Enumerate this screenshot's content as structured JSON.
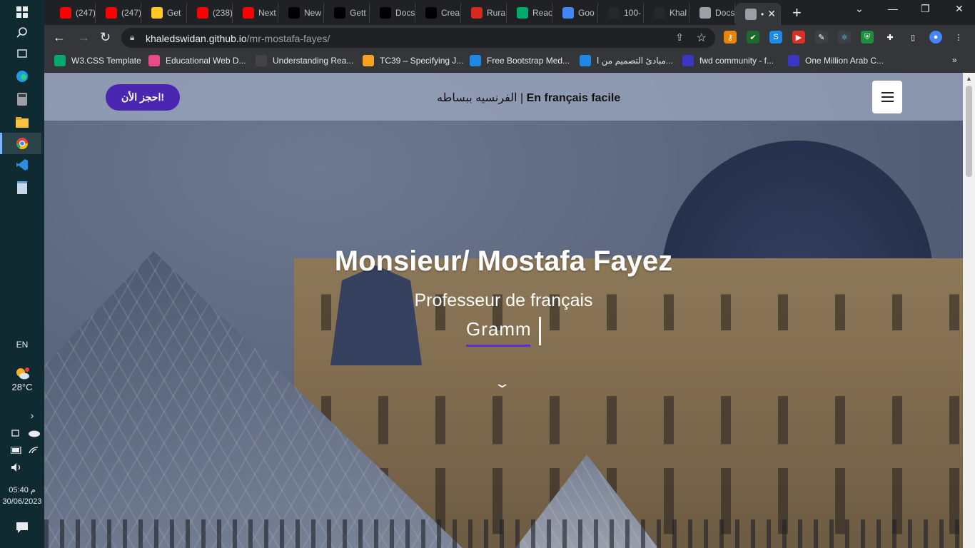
{
  "taskbar": {
    "lang": "EN",
    "weather_temp": "28°C",
    "time": "05:40 م",
    "date": "30/06/2023"
  },
  "tabs": [
    {
      "title": "(247)",
      "icon": "youtube-icon",
      "color": "#ff0000"
    },
    {
      "title": "(247)",
      "icon": "youtube-icon",
      "color": "#ff0000"
    },
    {
      "title": "Get",
      "icon": "firebase-icon",
      "color": "#ffca28"
    },
    {
      "title": "(238)",
      "icon": "youtube-icon",
      "color": "#ff0000"
    },
    {
      "title": "Next",
      "icon": "youtube-icon",
      "color": "#ff0000"
    },
    {
      "title": "New",
      "icon": "vercel-icon",
      "color": "#000000"
    },
    {
      "title": "Gett",
      "icon": "nextjs-icon",
      "color": "#000000"
    },
    {
      "title": "Docs",
      "icon": "nextjs-icon",
      "color": "#000000"
    },
    {
      "title": "Crea",
      "icon": "nextjs-icon",
      "color": "#000000"
    },
    {
      "title": "Rura",
      "icon": "canada-leaf-icon",
      "color": "#d52b1e"
    },
    {
      "title": "Reac",
      "icon": "w-icon",
      "color": "#04aa6d"
    },
    {
      "title": "Goo",
      "icon": "google-translate-icon",
      "color": "#4285f4"
    },
    {
      "title": "100-",
      "icon": "github-icon",
      "color": "#24292e"
    },
    {
      "title": "Khal",
      "icon": "github-icon",
      "color": "#24292e"
    },
    {
      "title": "Docs",
      "icon": "globe-icon",
      "color": "#9aa0a6"
    },
    {
      "title": "•",
      "icon": "globe-icon",
      "color": "#9aa0a6",
      "active": true
    }
  ],
  "toolbar": {
    "url_host": "khaledswidan.github.io",
    "url_path": "/mr-mostafa-fayes/"
  },
  "bookmarks": [
    {
      "label": "W3.CSS Template",
      "icon": "w3schools-icon",
      "color": "#04aa6d"
    },
    {
      "label": "Educational Web D...",
      "icon": "dribbble-icon",
      "color": "#ea4c89"
    },
    {
      "label": "Understanding Rea...",
      "icon": "film-icon",
      "color": "#444444"
    },
    {
      "label": "TC39 – Specifying J...",
      "icon": "tc39-icon",
      "color": "#f7a31c"
    },
    {
      "label": "Free Bootstrap Med...",
      "icon": "bird-icon",
      "color": "#1e88e5"
    },
    {
      "label": "مبادئ التصميم من ا...",
      "icon": "chat-icon",
      "color": "#1e88e5"
    },
    {
      "label": "fwd community - f...",
      "icon": "discourse-icon",
      "color": "#3b36c8"
    },
    {
      "label": "One Million Arab C...",
      "icon": "discourse-icon",
      "color": "#3b36c8"
    }
  ],
  "site": {
    "book_button": "احجز الأن!",
    "brand_ar": "الفرنسيه ببساطه | ",
    "brand_fr": "En français facile",
    "title": "Monsieur/ Mostafa Fayez",
    "subtitle": "Professeur de français",
    "typed": "Gramm"
  }
}
